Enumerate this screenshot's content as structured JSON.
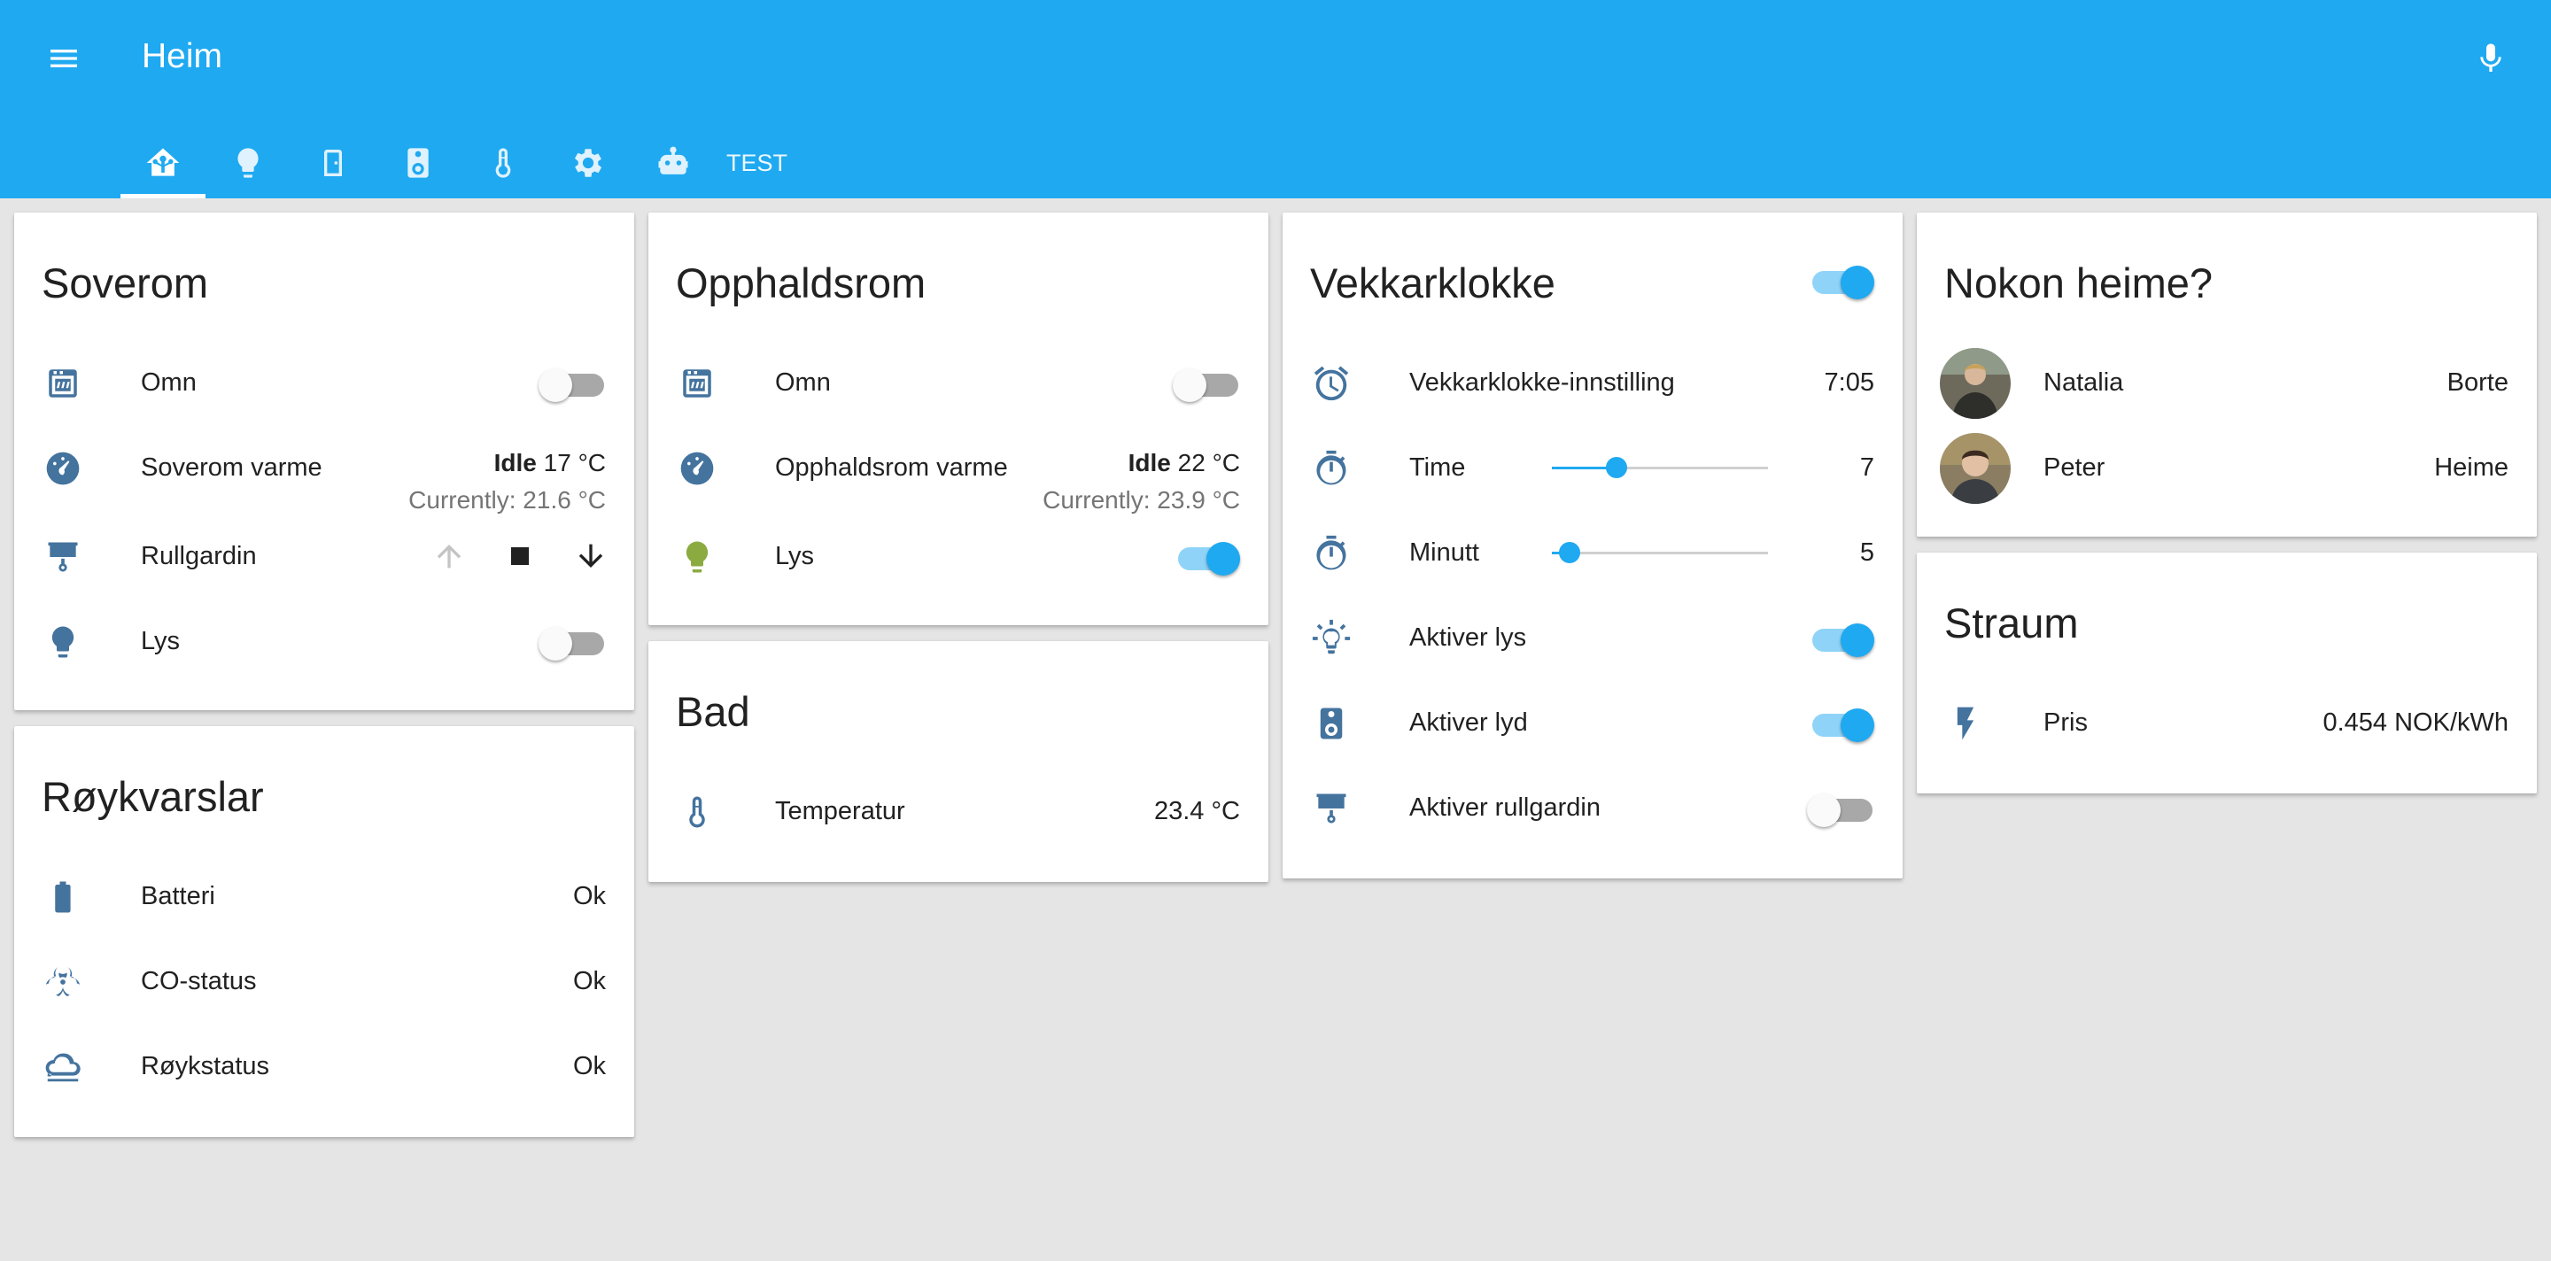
{
  "app": {
    "title": "Heim",
    "last_tab_label": "TEST"
  },
  "tabs": [
    {
      "icon": "home-automation-icon"
    },
    {
      "icon": "lightbulb-icon"
    },
    {
      "icon": "door-icon"
    },
    {
      "icon": "speaker-icon"
    },
    {
      "icon": "thermometer-icon"
    },
    {
      "icon": "gear-icon"
    },
    {
      "icon": "robot-icon"
    }
  ],
  "soverom": {
    "title": "Soverom",
    "omn": {
      "label": "Omn",
      "state": "off"
    },
    "varme": {
      "label": "Soverom varme",
      "state": "Idle",
      "target": "17 °C",
      "current": "Currently: 21.6 °C"
    },
    "rullgardin": {
      "label": "Rullgardin"
    },
    "lys": {
      "label": "Lys",
      "state": "off"
    }
  },
  "roykvarslar": {
    "title": "Røykvarslar",
    "batteri": {
      "label": "Batteri",
      "value": "Ok"
    },
    "co": {
      "label": "CO-status",
      "value": "Ok"
    },
    "royk": {
      "label": "Røykstatus",
      "value": "Ok"
    }
  },
  "opphaldsrom": {
    "title": "Opphaldsrom",
    "omn": {
      "label": "Omn",
      "state": "off"
    },
    "varme": {
      "label": "Opphaldsrom varme",
      "state": "Idle",
      "target": "22 °C",
      "current": "Currently: 23.9 °C"
    },
    "lys": {
      "label": "Lys",
      "state": "on"
    }
  },
  "bad": {
    "title": "Bad",
    "temperatur": {
      "label": "Temperatur",
      "value": "23.4 °C"
    }
  },
  "vekkarklokke": {
    "title": "Vekkarklokke",
    "enabled": "on",
    "innstilling": {
      "label": "Vekkarklokke-innstilling",
      "value": "7:05"
    },
    "time": {
      "label": "Time",
      "value": "7",
      "level": 0.3
    },
    "minutt": {
      "label": "Minutt",
      "value": "5",
      "level": 0.08
    },
    "lys": {
      "label": "Aktiver lys",
      "state": "on"
    },
    "lyd": {
      "label": "Aktiver lyd",
      "state": "on"
    },
    "rullgardin": {
      "label": "Aktiver rullgardin",
      "state": "off"
    }
  },
  "nokon_heime": {
    "title": "Nokon heime?",
    "people": [
      {
        "name": "Natalia",
        "state": "Borte"
      },
      {
        "name": "Peter",
        "state": "Heime"
      }
    ]
  },
  "straum": {
    "title": "Straum",
    "pris": {
      "label": "Pris",
      "value": "0.454 NOK/kWh"
    }
  },
  "colors": {
    "primary": "#1fa9f1",
    "icon": "#44739e",
    "light_on": "#8bab41"
  }
}
